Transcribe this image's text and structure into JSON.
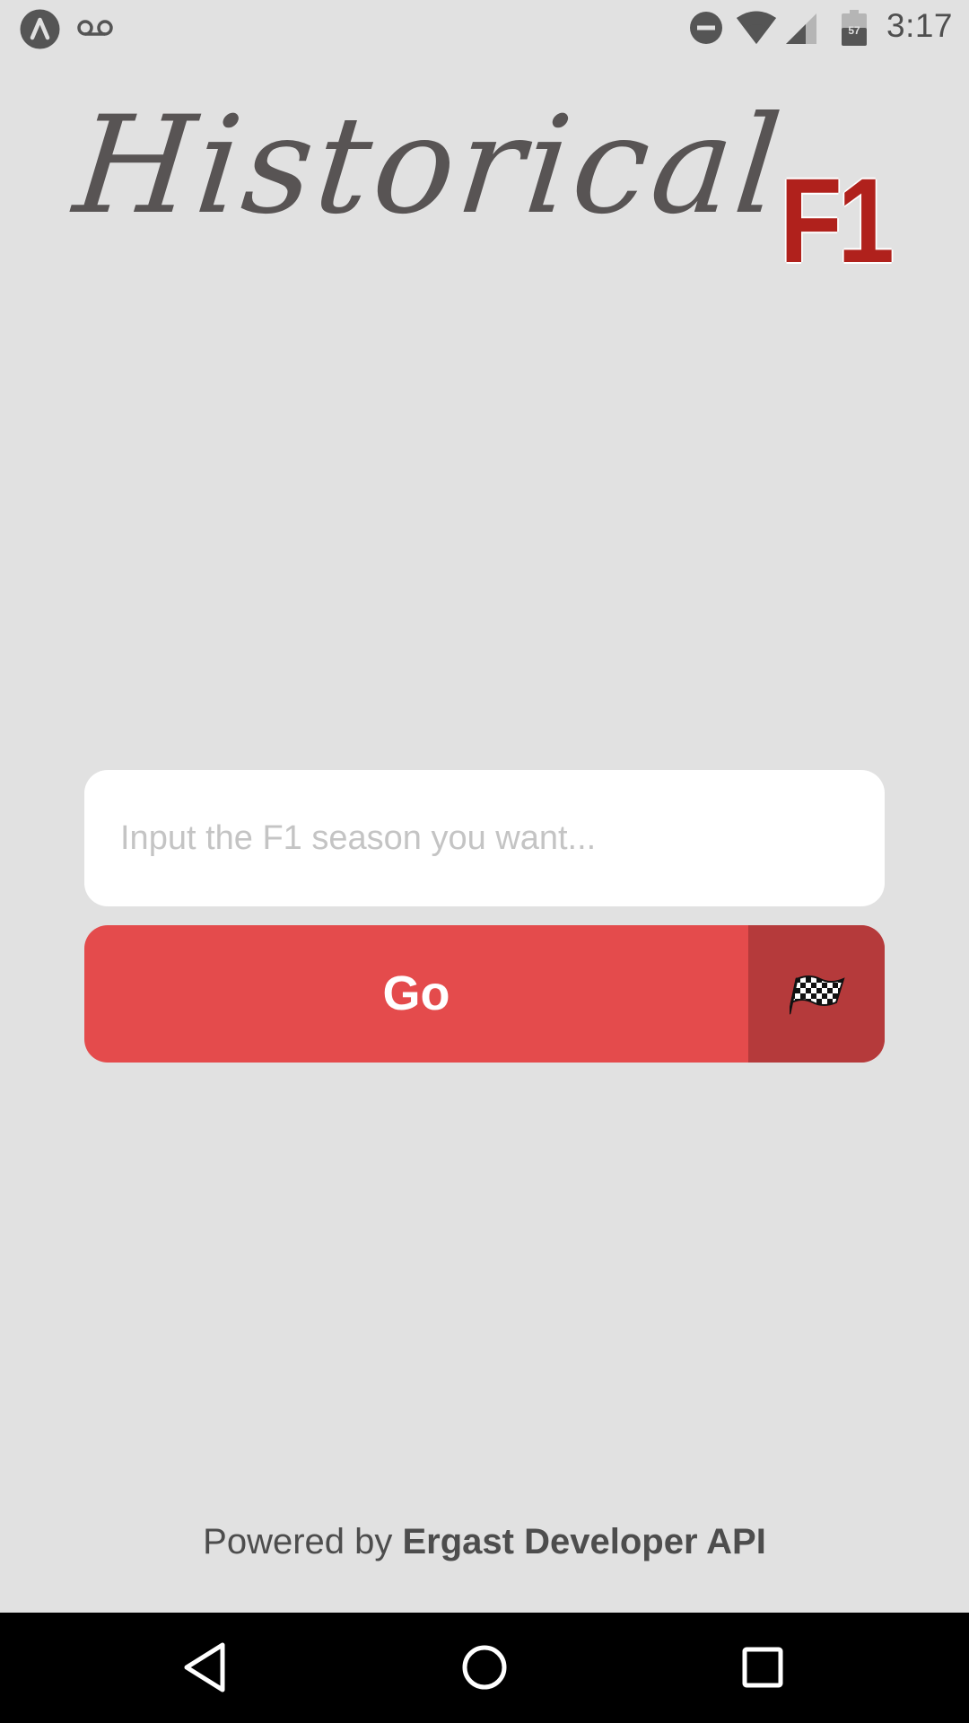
{
  "status_bar": {
    "time": "3:17",
    "battery_level": "57",
    "icons": [
      "app-icon",
      "voicemail-icon",
      "dnd-icon",
      "wifi-icon",
      "signal-icon",
      "battery-icon"
    ]
  },
  "logo": {
    "script_text": "Historical",
    "badge_text": "F1"
  },
  "search": {
    "placeholder": "Input the F1 season you want...",
    "value": ""
  },
  "go_button": {
    "label": "Go",
    "icon": "checkered-flag-icon"
  },
  "footer": {
    "prefix": "Powered by ",
    "brand": "Ergast Developer API"
  },
  "colors": {
    "background": "#e1e1e1",
    "button": "#e44b4c",
    "button_icon_area": "#b53a3b",
    "logo_red": "#b0211c",
    "logo_gray": "#585454"
  }
}
